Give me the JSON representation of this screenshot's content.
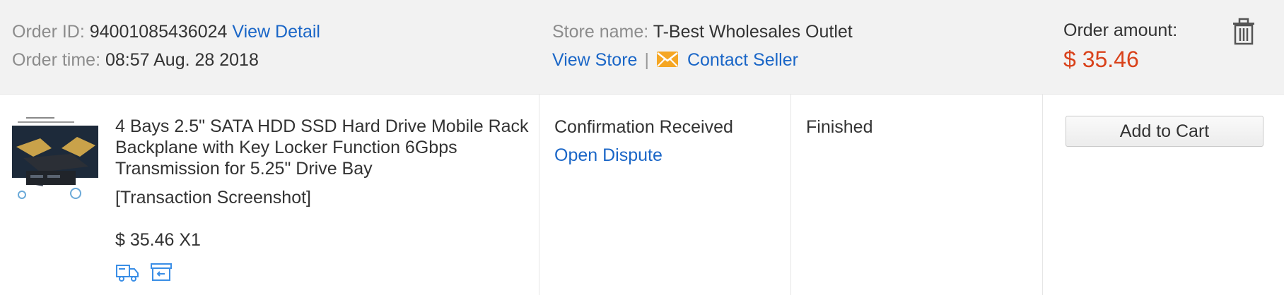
{
  "header": {
    "order_id_label": "Order ID:",
    "order_id": "94001085436024",
    "view_detail": "View Detail",
    "order_time_label": "Order time:",
    "order_time": "08:57 Aug. 28 2018",
    "store_name_label": "Store name:",
    "store_name": "T-Best Wholesales Outlet",
    "view_store": "View Store",
    "separator": "|",
    "contact_seller": "Contact Seller",
    "amount_label": "Order amount:",
    "amount": "$ 35.46"
  },
  "item": {
    "thumbnail_icon": "product-thumbnail",
    "title": "4 Bays 2.5\" SATA HDD SSD Hard Drive Mobile Rack Backplane with Key Locker Function 6Gbps Transmission for 5.25\" Drive Bay",
    "snapshot": "[Transaction Screenshot]",
    "price_qty": "$ 35.46 X1"
  },
  "status": {
    "state": "Confirmation Received",
    "open_dispute": "Open Dispute",
    "order_status": "Finished"
  },
  "actions": {
    "add_to_cart": "Add to Cart"
  },
  "colors": {
    "header_bg": "#f2f2f2",
    "link": "#1a66c7",
    "amount": "#d9421b",
    "mail_icon": "#f5a623"
  }
}
